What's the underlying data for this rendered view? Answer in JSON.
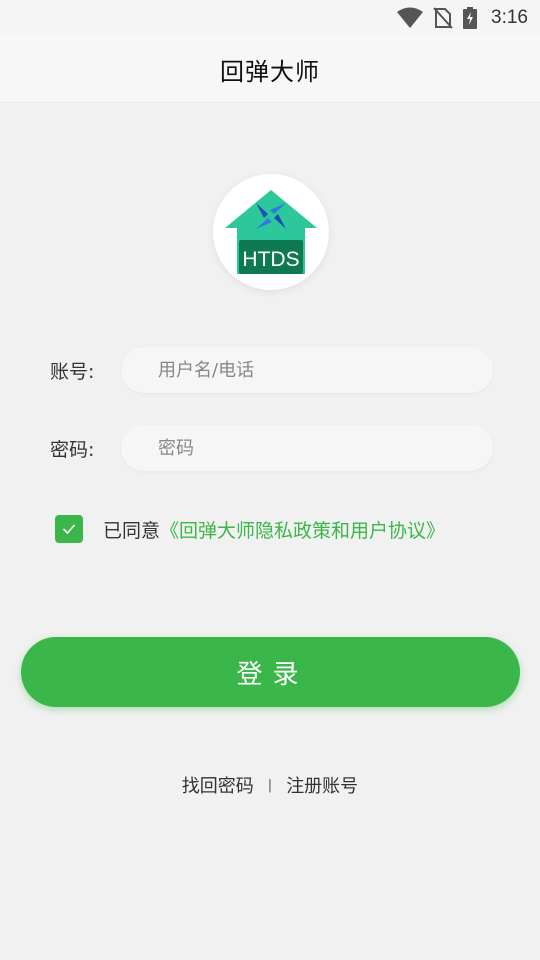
{
  "status_bar": {
    "time": "3:16",
    "icons": [
      "wifi-icon",
      "no-sim-icon",
      "battery-charging-icon"
    ]
  },
  "app_bar": {
    "title": "回弹大师"
  },
  "logo": {
    "text": "HTDS",
    "icon": "htds-house-logo-icon",
    "colors": {
      "roof": "#2cc79b",
      "body": "#0f7a52"
    }
  },
  "form": {
    "account": {
      "label": "账号:",
      "placeholder": "用户名/电话",
      "value": ""
    },
    "password": {
      "label": "密码:",
      "placeholder": "密码",
      "value": ""
    }
  },
  "agreement": {
    "checked": true,
    "prefix": "已同意",
    "link": "《回弹大师隐私政策和用户协议》"
  },
  "login_button": {
    "label": "登录"
  },
  "links": {
    "forgot_password": "找回密码",
    "separator": "|",
    "register": "注册账号"
  },
  "colors": {
    "accent": "#3bb64a",
    "background": "#f1f1f1"
  }
}
